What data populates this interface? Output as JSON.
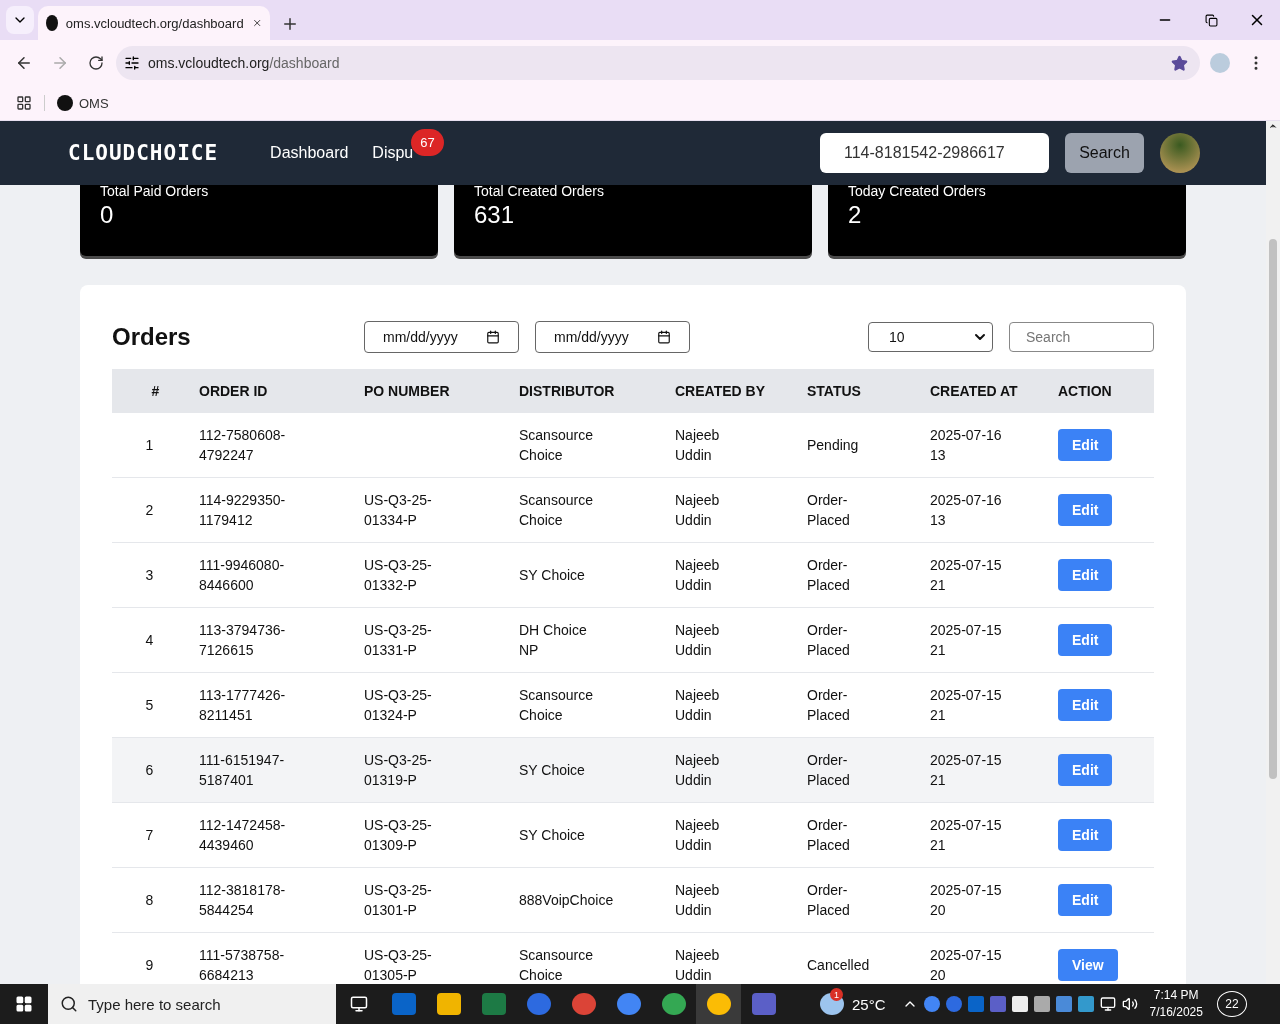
{
  "browser": {
    "tab_title": "oms.vcloudtech.org/dashboard",
    "url_host": "oms.vcloudtech.org",
    "url_path": "/dashboard",
    "bookmarks": [
      "OMS"
    ]
  },
  "navbar": {
    "logo": "CLOUDCHOICE",
    "links": [
      {
        "label": "Dashboard"
      },
      {
        "label": "Dispu",
        "badge": "67"
      }
    ],
    "search_value": "114-8181542-2986617",
    "search_button": "Search"
  },
  "stats": [
    {
      "label": "Total Paid Orders",
      "value": "0"
    },
    {
      "label": "Total Created Orders",
      "value": "631"
    },
    {
      "label": "Today Created Orders",
      "value": "2"
    }
  ],
  "orders": {
    "title": "Orders",
    "date_from": "mm/dd/yyyy",
    "date_to": "mm/dd/yyyy",
    "page_size": "10",
    "search_placeholder": "Search",
    "columns": [
      "#",
      "ORDER ID",
      "PO NUMBER",
      "DISTRIBUTOR",
      "CREATED BY",
      "STATUS",
      "CREATED AT",
      "ACTION"
    ],
    "rows": [
      {
        "n": "1",
        "order_id": "112-7580608-4792247",
        "po": "",
        "distributor": "Scansource Choice",
        "created_by": "Najeeb Uddin",
        "status": "Pending",
        "created_at": "2025-07-16 13",
        "action": "Edit",
        "highlighted": false
      },
      {
        "n": "2",
        "order_id": "114-9229350-1179412",
        "po": "US-Q3-25-01334-P",
        "distributor": "Scansource Choice",
        "created_by": "Najeeb Uddin",
        "status": "Order-Placed",
        "created_at": "2025-07-16 13",
        "action": "Edit",
        "highlighted": false
      },
      {
        "n": "3",
        "order_id": "111-9946080-8446600",
        "po": "US-Q3-25-01332-P",
        "distributor": "SY Choice",
        "created_by": "Najeeb Uddin",
        "status": "Order-Placed",
        "created_at": "2025-07-15 21",
        "action": "Edit",
        "highlighted": false
      },
      {
        "n": "4",
        "order_id": "113-3794736-7126615",
        "po": "US-Q3-25-01331-P",
        "distributor": "DH Choice NP",
        "created_by": "Najeeb Uddin",
        "status": "Order-Placed",
        "created_at": "2025-07-15 21",
        "action": "Edit",
        "highlighted": false
      },
      {
        "n": "5",
        "order_id": "113-1777426-8211451",
        "po": "US-Q3-25-01324-P",
        "distributor": "Scansource Choice",
        "created_by": "Najeeb Uddin",
        "status": "Order-Placed",
        "created_at": "2025-07-15 21",
        "action": "Edit",
        "highlighted": false
      },
      {
        "n": "6",
        "order_id": "111-6151947-5187401",
        "po": "US-Q3-25-01319-P",
        "distributor": "SY Choice",
        "created_by": "Najeeb Uddin",
        "status": "Order-Placed",
        "created_at": "2025-07-15 21",
        "action": "Edit",
        "highlighted": true
      },
      {
        "n": "7",
        "order_id": "112-1472458-4439460",
        "po": "US-Q3-25-01309-P",
        "distributor": "SY Choice",
        "created_by": "Najeeb Uddin",
        "status": "Order-Placed",
        "created_at": "2025-07-15 21",
        "action": "Edit",
        "highlighted": false
      },
      {
        "n": "8",
        "order_id": "112-3818178-5844254",
        "po": "US-Q3-25-01301-P",
        "distributor": "888VoipChoice",
        "created_by": "Najeeb Uddin",
        "status": "Order-Placed",
        "created_at": "2025-07-15 20",
        "action": "Edit",
        "highlighted": false
      },
      {
        "n": "9",
        "order_id": "111-5738758-6684213",
        "po": "US-Q3-25-01305-P",
        "distributor": "Scansource Choice",
        "created_by": "Najeeb Uddin",
        "status": "Cancelled",
        "created_at": "2025-07-15 20",
        "action": "View",
        "highlighted": false
      }
    ]
  },
  "taskbar": {
    "search_placeholder": "Type here to search",
    "weather_badge": "1",
    "temperature": "25°C",
    "time": "7:14 PM",
    "date": "7/16/2025",
    "notifications": "22"
  }
}
